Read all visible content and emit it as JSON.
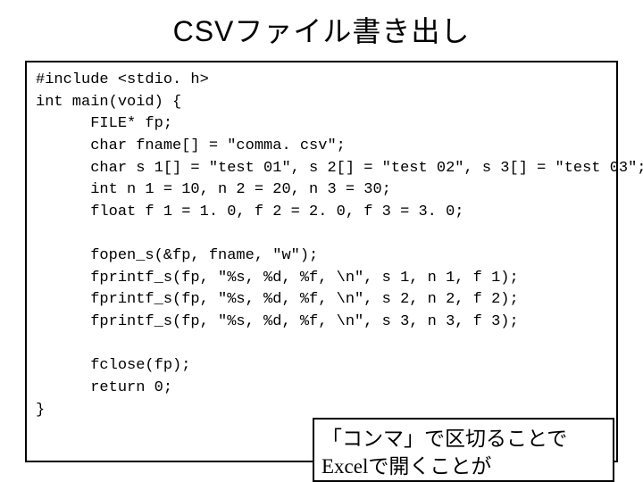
{
  "title": "CSVファイル書き出し",
  "code": "#include <stdio. h>\nint main(void) {\n      FILE* fp;\n      char fname[] = \"comma. csv\";\n      char s 1[] = \"test 01\", s 2[] = \"test 02\", s 3[] = \"test 03\";\n      int n 1 = 10, n 2 = 20, n 3 = 30;\n      float f 1 = 1. 0, f 2 = 2. 0, f 3 = 3. 0;\n\n      fopen_s(&fp, fname, \"w\");\n      fprintf_s(fp, \"%s, %d, %f, \\n\", s 1, n 1, f 1);\n      fprintf_s(fp, \"%s, %d, %f, \\n\", s 2, n 2, f 2);\n      fprintf_s(fp, \"%s, %d, %f, \\n\", s 3, n 3, f 3);\n\n      fclose(fp);\n      return 0;\n}",
  "note": "「コンマ」で区切ることでExcelで開くことが"
}
